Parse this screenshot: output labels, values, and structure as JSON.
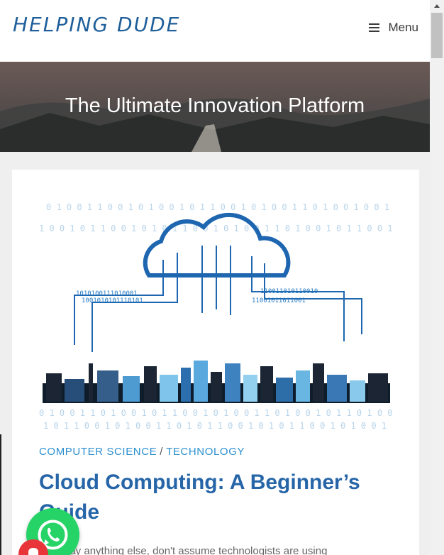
{
  "header": {
    "logo": "HELPING DUDE",
    "menu_label": "Menu"
  },
  "hero": {
    "title": "The Ultimate Innovation Platform"
  },
  "post": {
    "categories": [
      "COMPUTER SCIENCE",
      "TECHNOLOGY"
    ],
    "category_separator": "/",
    "title": "Cloud Computing: A Beginner’s Guide",
    "excerpt": "…e I say anything else, don't assume technologists are using"
  },
  "colors": {
    "brand": "#1f5f9a",
    "category": "#2c8fcf",
    "title": "#2666a8",
    "whatsapp": "#25d366"
  }
}
